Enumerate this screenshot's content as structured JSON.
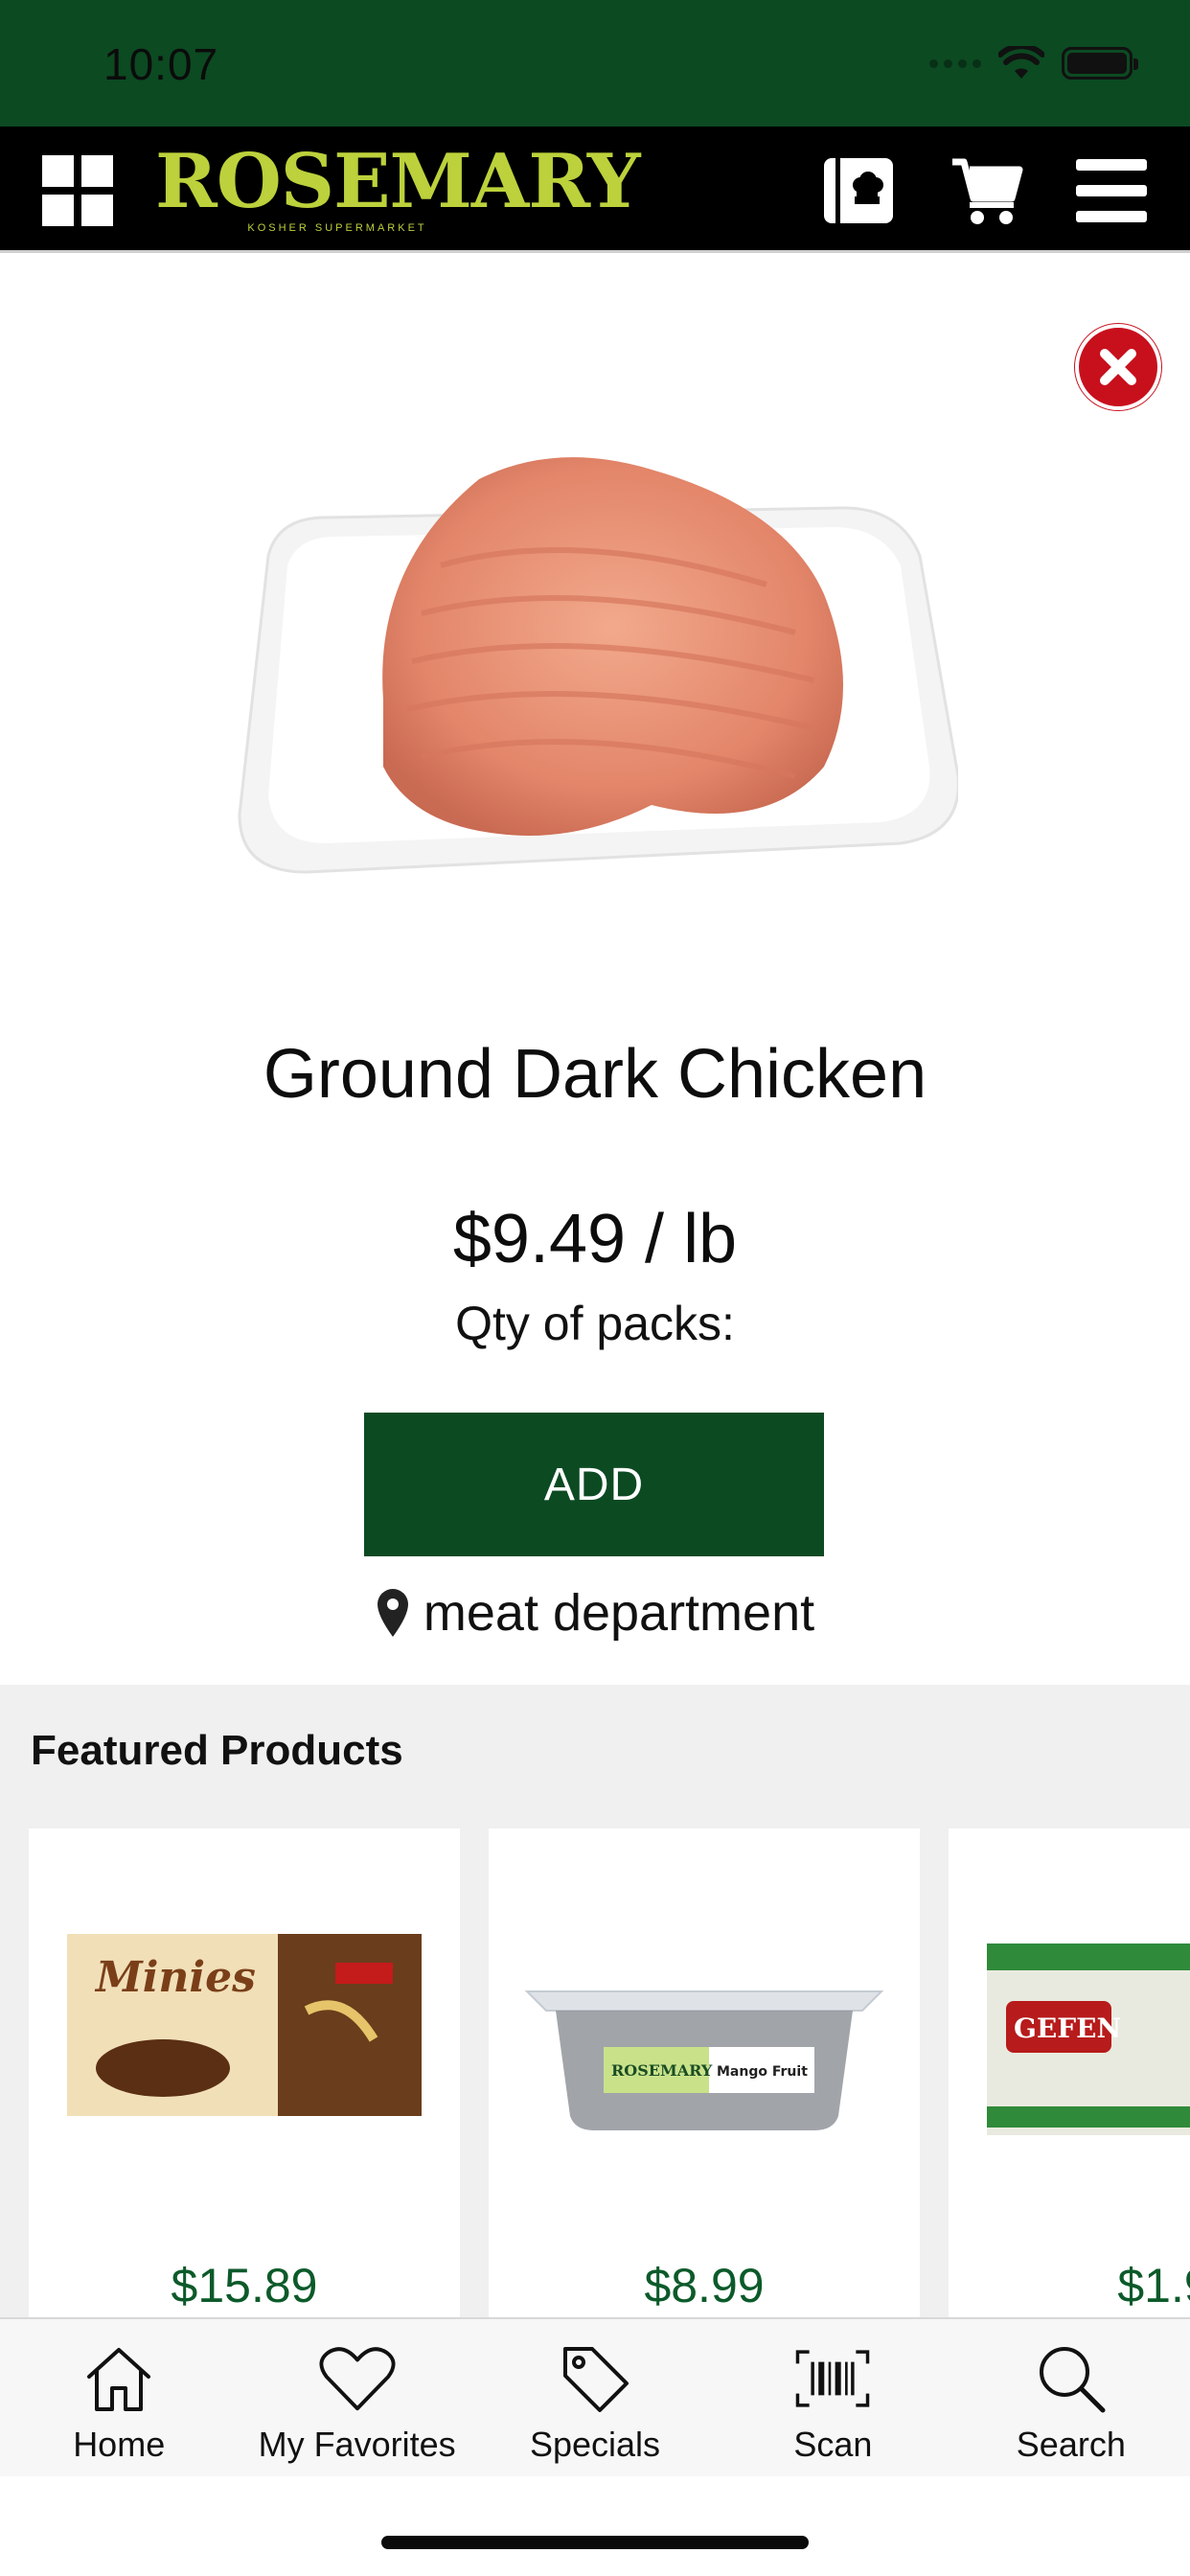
{
  "status_bar": {
    "time": "10:07"
  },
  "header": {
    "logo_text": "ROSEMARY",
    "logo_subtitle": "KOSHER SUPERMARKET",
    "icons": [
      "grid-icon",
      "recipe-book-icon",
      "cart-icon",
      "hamburger-menu-icon"
    ]
  },
  "product": {
    "name": "Ground Dark Chicken",
    "price": "$9.49 / lb",
    "qty_label": "Qty of packs:",
    "add_label": "ADD",
    "location": "meat department"
  },
  "featured": {
    "title": "Featured Products",
    "items": [
      {
        "price": "$15.89"
      },
      {
        "price": "$8.99"
      },
      {
        "price": "$1.9"
      }
    ]
  },
  "tabs": [
    {
      "label": "Home",
      "icon": "home-icon"
    },
    {
      "label": "My Favorites",
      "icon": "heart-icon"
    },
    {
      "label": "Specials",
      "icon": "tag-icon"
    },
    {
      "label": "Scan",
      "icon": "barcode-scan-icon"
    },
    {
      "label": "Search",
      "icon": "search-icon"
    }
  ],
  "colors": {
    "brand_green": "#0c4a22",
    "logo_yellow": "#bcd13b",
    "close_red": "#c8101d",
    "price_green": "#0c5a2a"
  }
}
